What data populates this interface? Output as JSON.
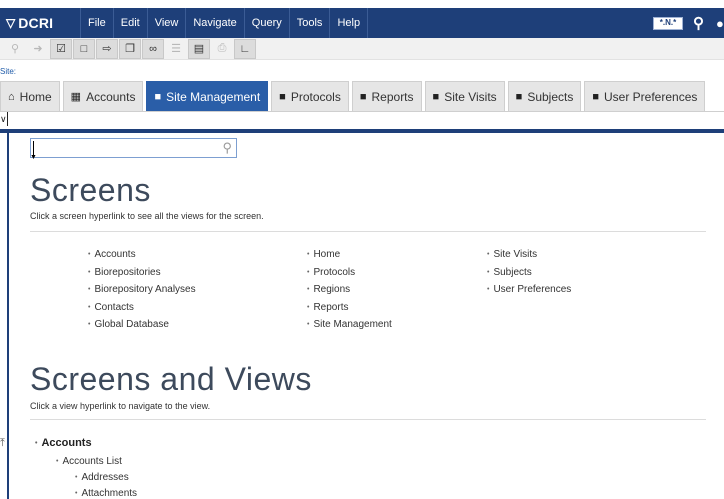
{
  "menubar": {
    "brand": "DCRI",
    "items": [
      "File",
      "Edit",
      "View",
      "Navigate",
      "Query",
      "Tools",
      "Help"
    ],
    "flag_label": "*.N.*"
  },
  "toolbar": {
    "icons": [
      "search-icon",
      "go-icon",
      "checklist-icon",
      "new-doc-icon",
      "export-icon",
      "copy-icon",
      "link-icon",
      "list-icon",
      "clipboard-icon",
      "print-icon",
      "chart-icon"
    ]
  },
  "site": {
    "label": "Site:"
  },
  "tabs": [
    {
      "label": "Home",
      "icon": "home-icon",
      "active": false
    },
    {
      "label": "Accounts",
      "icon": "grid-icon",
      "active": false
    },
    {
      "label": "Site Management",
      "icon": "folder-icon",
      "active": true
    },
    {
      "label": "Protocols",
      "icon": "folder-icon",
      "active": false
    },
    {
      "label": "Reports",
      "icon": "folder-icon",
      "active": false
    },
    {
      "label": "Site Visits",
      "icon": "folder-icon",
      "active": false
    },
    {
      "label": "Subjects",
      "icon": "folder-icon",
      "active": false
    },
    {
      "label": "User Preferences",
      "icon": "folder-icon",
      "active": false
    }
  ],
  "search": {
    "value": ""
  },
  "screens": {
    "title": "Screens",
    "subtitle": "Click a screen hyperlink to see all the views for the screen.",
    "col1": [
      "Accounts",
      "Biorepositories",
      "Biorepository Analyses",
      "Contacts",
      "Global Database"
    ],
    "col2": [
      "Home",
      "Protocols",
      "Regions",
      "Reports",
      "Site Management"
    ],
    "col3": [
      "Site Visits",
      "Subjects",
      "User Preferences"
    ]
  },
  "screens_views": {
    "title": "Screens and Views",
    "subtitle": "Click a view hyperlink to navigate to the view.",
    "tree": {
      "root": "Accounts",
      "level1": "Accounts List",
      "level2": [
        "Addresses",
        "Attachments"
      ]
    }
  },
  "colors": {
    "brand": "#1e3f79",
    "active_tab": "#2a5ea8"
  }
}
